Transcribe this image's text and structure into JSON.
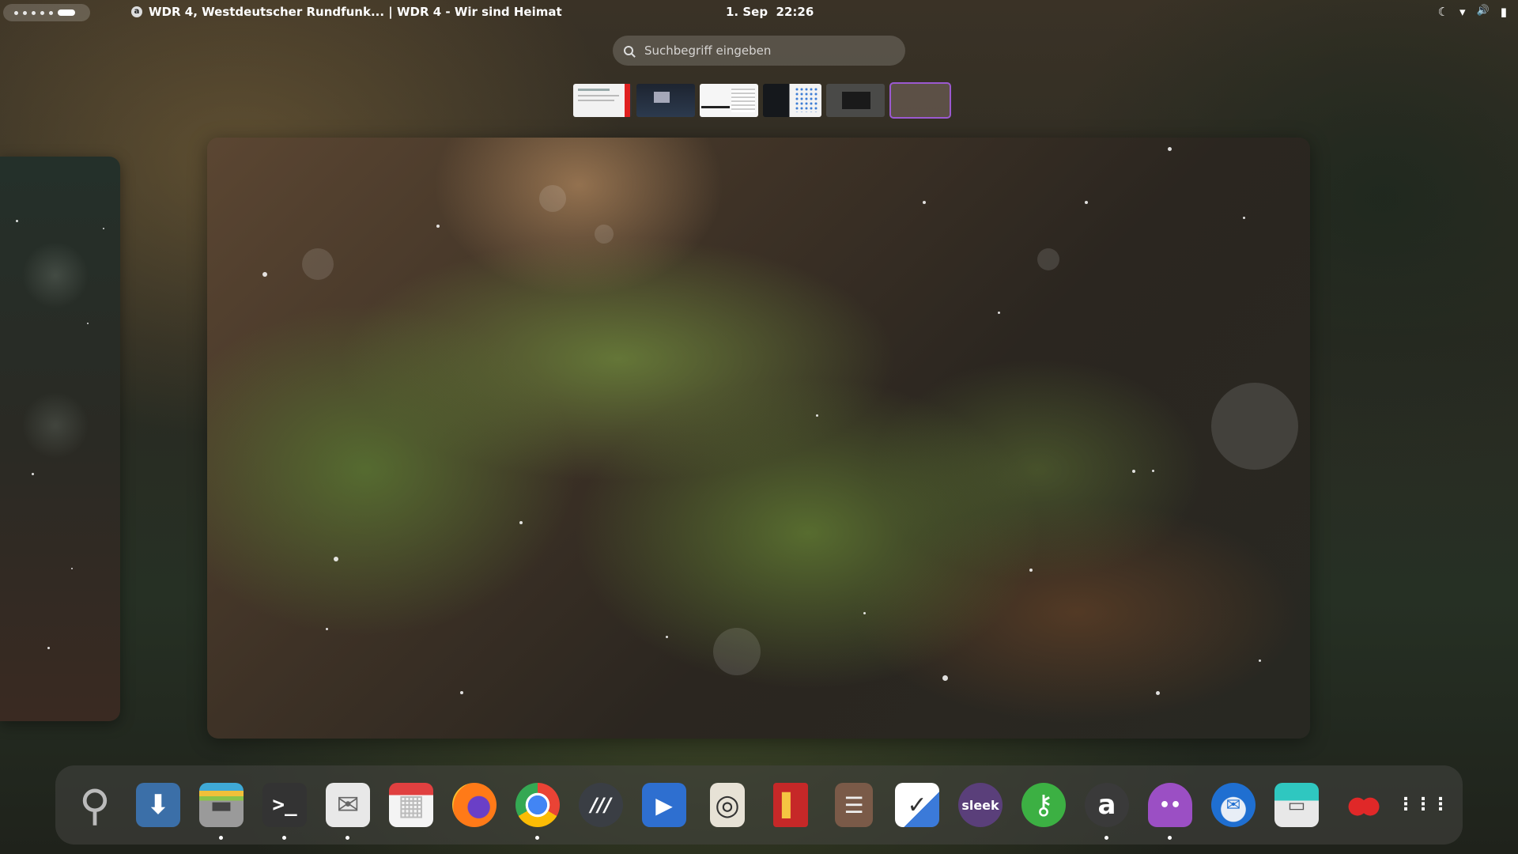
{
  "topbar": {
    "window_title": "WDR 4, Westdeutscher Rundfunk... | WDR 4 - Wir sind Heimat",
    "app_icon_glyph": "a",
    "date": "1. Sep",
    "time": "22:26",
    "tray": {
      "night_light_glyph": "☾",
      "wifi_glyph": "▾",
      "volume_glyph": "🔊",
      "battery_glyph": "▮"
    }
  },
  "search": {
    "placeholder": "Suchbegriff eingeben",
    "value": ""
  },
  "workspaces": {
    "count": 6,
    "active_index": 6
  },
  "dock": {
    "items": [
      {
        "icon": "magnifier-icon",
        "glyph": "⚲",
        "running": false
      },
      {
        "icon": "downloads-icon",
        "glyph": "⬇",
        "running": false
      },
      {
        "icon": "files-icon",
        "glyph": "▬",
        "running": true
      },
      {
        "icon": "terminal-icon",
        "glyph": ">_",
        "running": true
      },
      {
        "icon": "mail-scheduler-icon",
        "glyph": "✉",
        "running": true
      },
      {
        "icon": "calendar-icon",
        "glyph": "▦",
        "running": false
      },
      {
        "icon": "firefox-icon",
        "glyph": "●",
        "running": false
      },
      {
        "icon": "chrome-icon",
        "glyph": "◉",
        "running": true
      },
      {
        "icon": "zoom-like-icon",
        "glyph": "///",
        "running": false
      },
      {
        "icon": "video-player-icon",
        "glyph": "▶",
        "running": false
      },
      {
        "icon": "speaker-icon",
        "glyph": "◎",
        "running": false
      },
      {
        "icon": "book-icon",
        "glyph": "▌",
        "running": false
      },
      {
        "icon": "clipboard-icon",
        "glyph": "☰",
        "running": false
      },
      {
        "icon": "tasks-icon",
        "glyph": "✓",
        "running": false
      },
      {
        "icon": "sleek-icon",
        "glyph": "sleek",
        "running": false
      },
      {
        "icon": "keyring-icon",
        "glyph": "⚷",
        "running": false
      },
      {
        "icon": "amazon-icon",
        "glyph": "a",
        "running": true
      },
      {
        "icon": "ghost-chat-icon",
        "glyph": "••",
        "running": true
      },
      {
        "icon": "thunderbird-icon",
        "glyph": "✉",
        "running": false
      },
      {
        "icon": "scanner-icon",
        "glyph": "▭",
        "running": false
      },
      {
        "icon": "cherry-icon",
        "glyph": "●●",
        "running": false
      },
      {
        "icon": "app-grid-icon",
        "glyph": "⋮⋮⋮",
        "running": false
      }
    ]
  },
  "colors": {
    "selection_accent": "#9b59d0",
    "panel_text": "#ffffff"
  }
}
